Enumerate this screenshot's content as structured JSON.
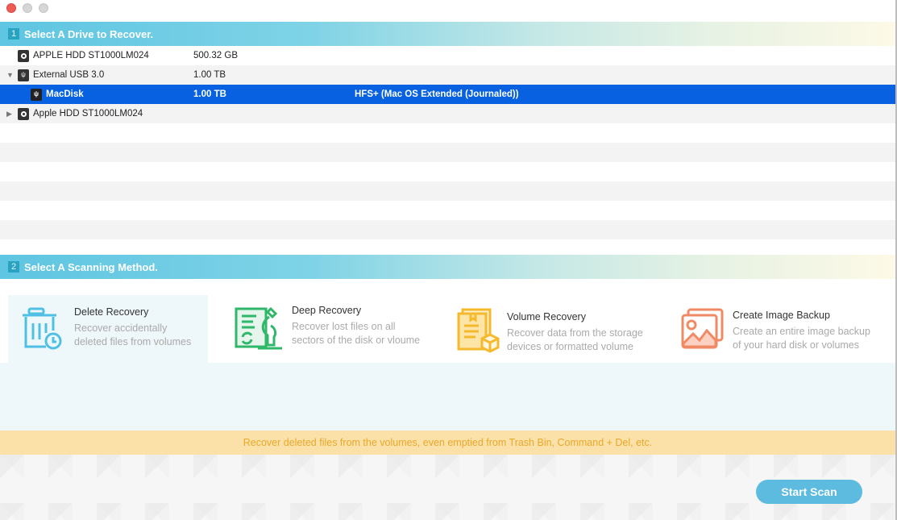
{
  "window": {
    "traffic_lights": [
      "close",
      "minimize",
      "maximize"
    ]
  },
  "section1": {
    "number": "1",
    "title": "Select A Drive to Recover."
  },
  "drives": [
    {
      "name": "APPLE HDD ST1000LM024",
      "size": "500.32 GB",
      "fs": "",
      "icon": "hdd-icon",
      "level": 0,
      "disclosure": "",
      "selected": false
    },
    {
      "name": "External USB 3.0",
      "size": "1.00 TB",
      "fs": "",
      "icon": "usb-drive-icon",
      "level": 0,
      "disclosure": "expanded",
      "selected": false
    },
    {
      "name": "MacDisk",
      "size": "1.00 TB",
      "fs": "HFS+ (Mac OS Extended (Journaled))",
      "icon": "volume-icon",
      "level": 1,
      "disclosure": "",
      "selected": true
    },
    {
      "name": "Apple HDD ST1000LM024",
      "size": "",
      "fs": "",
      "icon": "hdd-icon",
      "level": 0,
      "disclosure": "collapsed",
      "selected": false
    }
  ],
  "section2": {
    "number": "2",
    "title": "Select A Scanning Method."
  },
  "methods": [
    {
      "title": "Delete Recovery",
      "desc1": "Recover accidentally",
      "desc2": "deleted files from volumes",
      "icon": "trash-clock-icon",
      "color": "#4fc0e4",
      "active": true
    },
    {
      "title": "Deep Recovery",
      "desc1": "Recover lost files on all",
      "desc2": "sectors of the disk or vloume",
      "icon": "document-microscope-icon",
      "color": "#2fb76a",
      "active": false
    },
    {
      "title": "Volume Recovery",
      "desc1": "Recover data from the storage",
      "desc2": "devices or formatted volume",
      "icon": "folder-box-icon",
      "color": "#f5b92e",
      "active": false
    },
    {
      "title": "Create Image Backup",
      "desc1": "Create an entire image backup",
      "desc2": "of your hard disk or volumes",
      "icon": "image-stack-icon",
      "color": "#f08a65",
      "active": false
    }
  ],
  "tip": "Recover deleted files from the volumes, even emptied from Trash Bin, Command + Del, etc.",
  "start_scan_label": "Start Scan",
  "colors": {
    "selection": "#0761e0",
    "header_start": "#5ec5e2",
    "tip_bg": "#fbe0a8",
    "tip_text": "#e8a92a",
    "button": "#5dbbe0"
  }
}
